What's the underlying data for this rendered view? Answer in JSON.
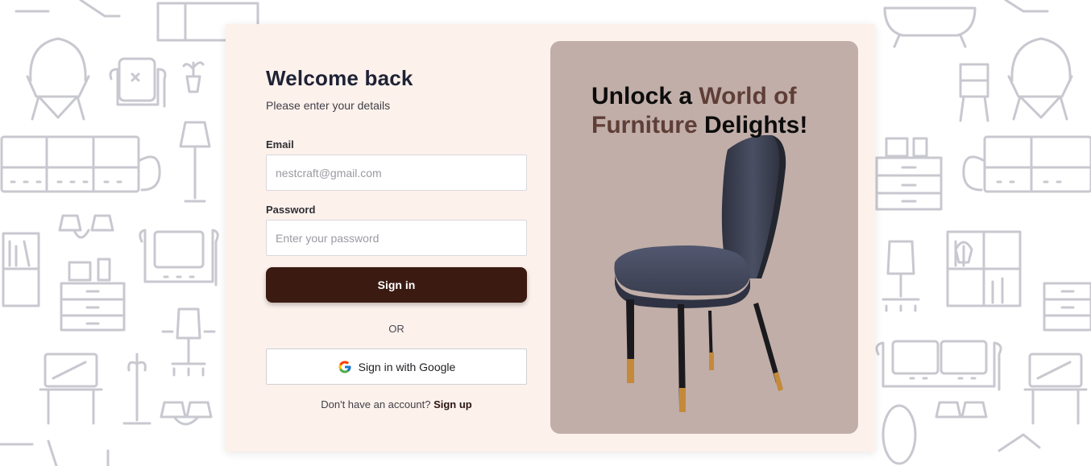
{
  "login": {
    "title": "Welcome back",
    "subtitle": "Please enter your details",
    "email_label": "Email",
    "email_placeholder": "nestcraft@gmail.com",
    "password_label": "Password",
    "password_placeholder": "Enter your password",
    "signin_label": "Sign in",
    "or_label": "OR",
    "google_label": "Sign in with Google",
    "no_account_text": "Don't have an account? ",
    "signup_label": "Sign up"
  },
  "promo": {
    "part1": "Unlock a ",
    "part2": "World of Furniture",
    "part3": " Delights!"
  },
  "colors": {
    "card_background": "#fdf1ec",
    "primary_button": "#3b1a12",
    "promo_panel": "#c1aea8",
    "accent_text": "#5e3e36",
    "pattern_line": "#c8c8d0"
  },
  "icons": {
    "google": "google-logo-icon",
    "hero_image": "chair-illustration"
  }
}
